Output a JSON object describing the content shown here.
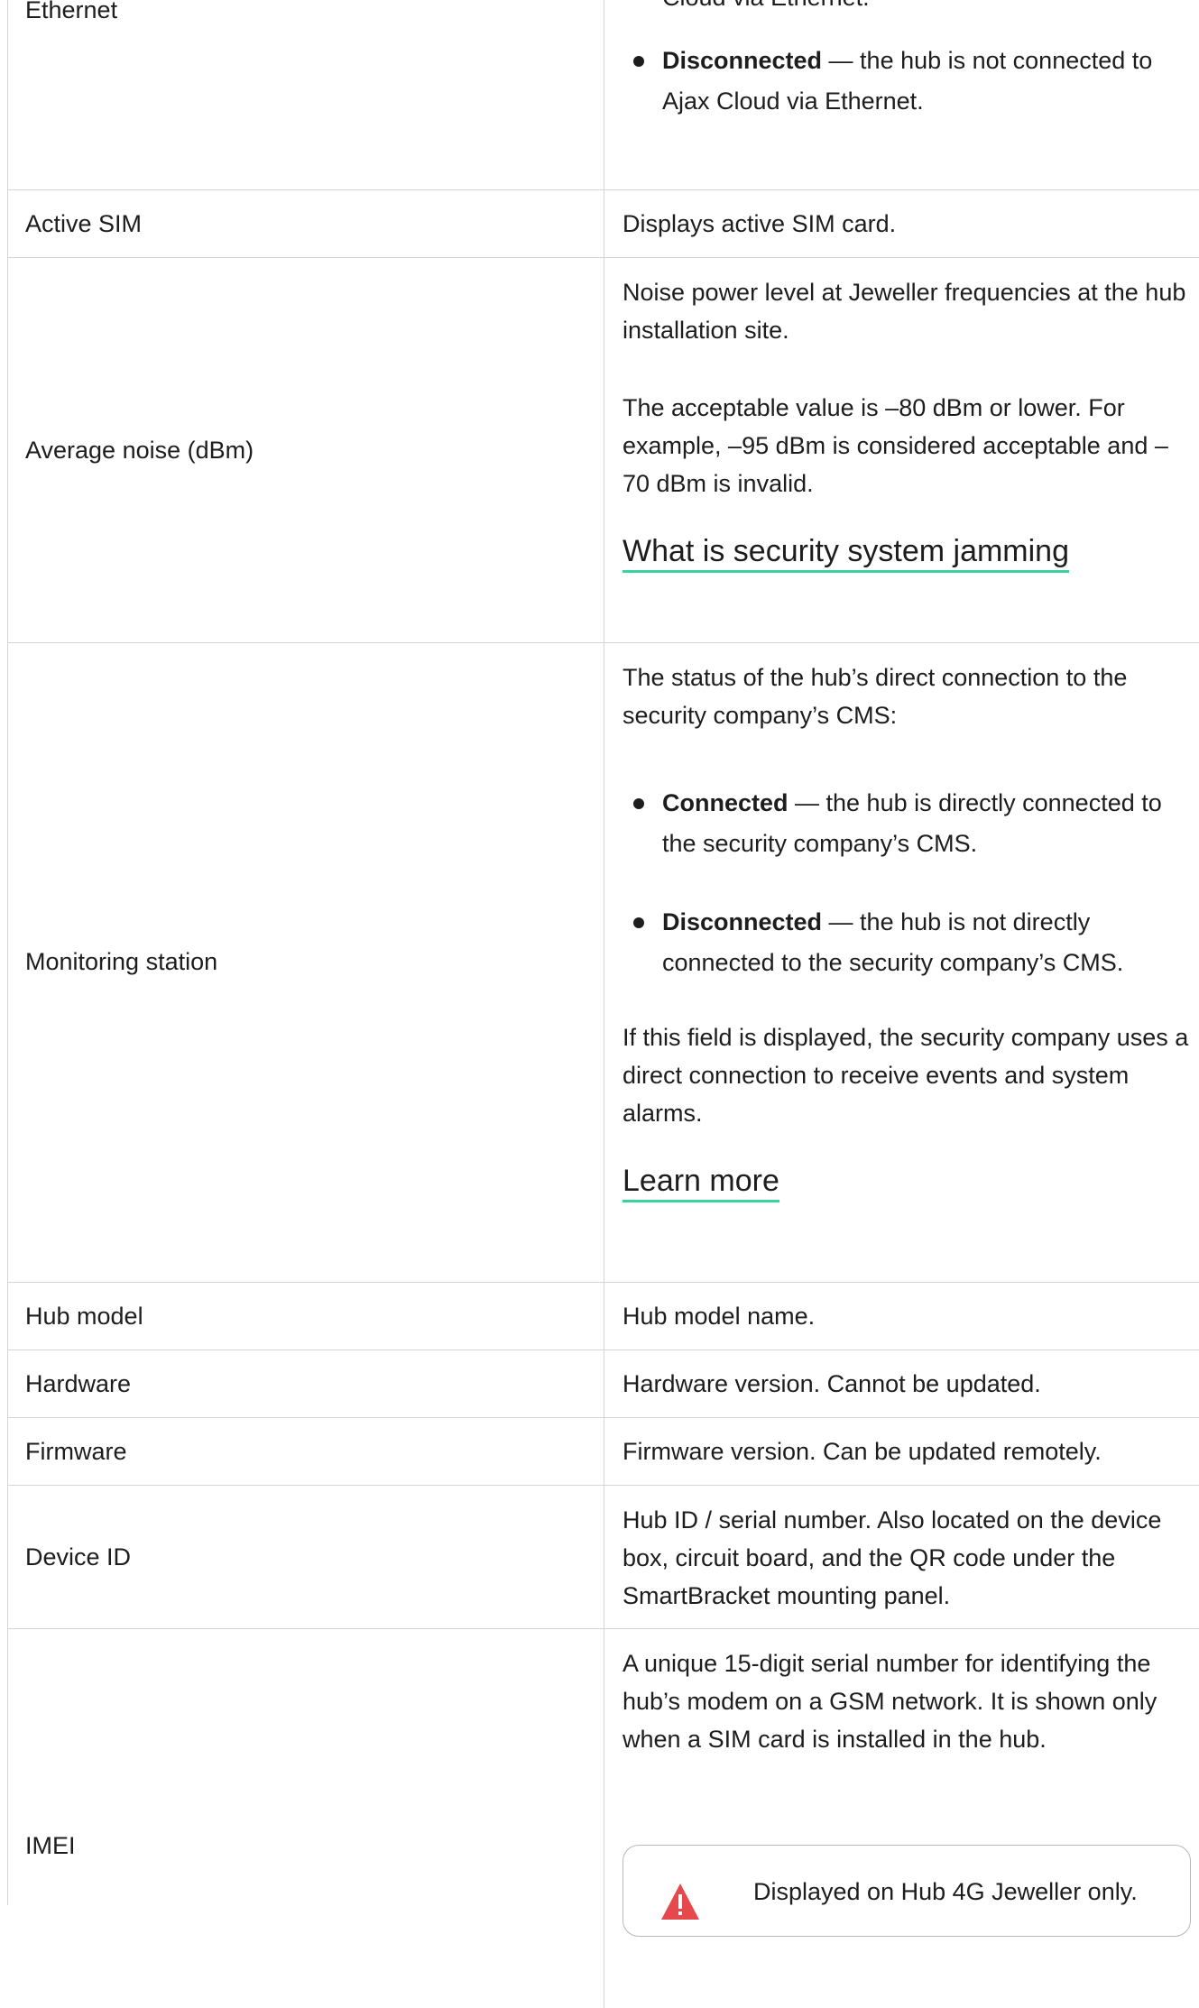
{
  "rows": {
    "ethernet": {
      "label": "Ethernet",
      "cont": "Cloud via Ethernet.",
      "bullet_term": "Disconnected",
      "bullet_rest": " — the hub is not connected to Ajax Cloud via Ethernet."
    },
    "active_sim": {
      "label": "Active SIM",
      "desc": "Displays active SIM card."
    },
    "average_noise": {
      "label": "Average noise (dBm)",
      "p1": "Noise power level at Jeweller frequencies at the hub installation site.",
      "p2": "The acceptable value is –80 dBm or lower. For example, –95 dBm is considered acceptable and –70 dBm is invalid.",
      "link": "What is security system jamming"
    },
    "monitoring_station": {
      "label": "Monitoring station",
      "p1": "The status of the hub’s direct connection to the security company’s CMS:",
      "b1_term": "Connected",
      "b1_rest": " — the hub is directly connected to the security company’s CMS.",
      "b2_term": "Disconnected",
      "b2_rest": " — the hub is not directly connected to the security company’s CMS.",
      "p2": "If this field is displayed, the security company uses a direct connection to receive events and system alarms.",
      "link": "Learn more"
    },
    "hub_model": {
      "label": "Hub model",
      "desc": "Hub model name."
    },
    "hardware": {
      "label": "Hardware",
      "desc": "Hardware version. Cannot be updated."
    },
    "firmware": {
      "label": "Firmware",
      "desc": "Firmware version. Can be updated remotely."
    },
    "device_id": {
      "label": "Device ID",
      "desc": "Hub ID / serial number. Also located on the device box, circuit board, and the QR code under the SmartBracket mounting panel."
    },
    "imei": {
      "label": "IMEI",
      "desc": "A unique 15-digit serial number for identifying the hub’s modem on a GSM network. It is shown only when a SIM card is installed in the hub.",
      "note": "Displayed on Hub 4G Jeweller only."
    }
  },
  "colors": {
    "border": "#d4d4d4",
    "link_underline": "#3ad3a0",
    "warning": "#e5484d"
  },
  "icons": {
    "note": "warning-icon"
  }
}
